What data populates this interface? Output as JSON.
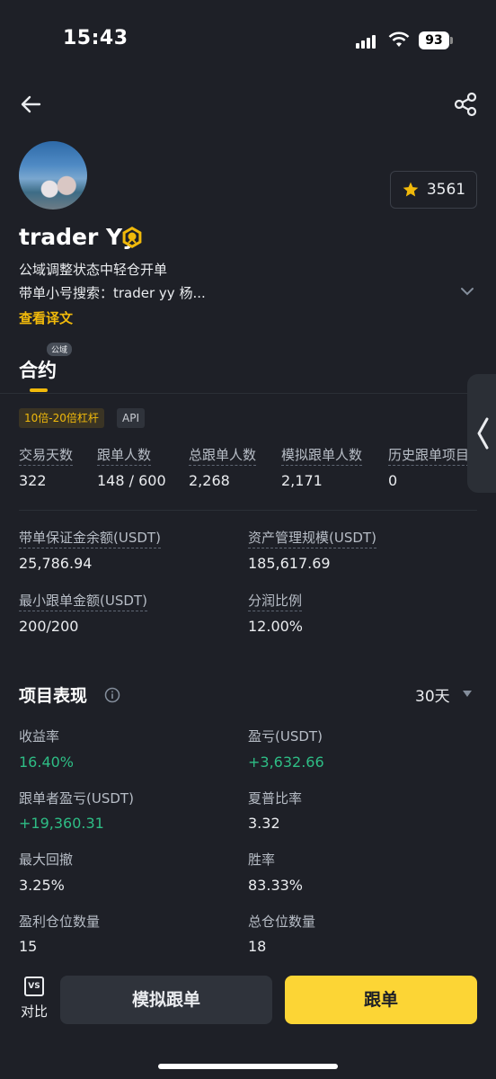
{
  "status_bar": {
    "time": "15:43",
    "battery": "93"
  },
  "profile": {
    "name": "trader Yy",
    "favorites": "3561",
    "bio_line1": "公域调整状态中轻仓开单",
    "bio_line2": "带单小号搜索：trader yy 杨...",
    "translate_link": "查看译文"
  },
  "tabs": {
    "public_tag": "公域",
    "contract": "合约"
  },
  "tags": {
    "leverage": "10倍-20倍杠杆",
    "api": "API"
  },
  "stats": [
    {
      "label": "交易天数",
      "value": "322"
    },
    {
      "label": "跟单人数",
      "value": "148 / 600"
    },
    {
      "label": "总跟单人数",
      "value": "2,268"
    },
    {
      "label": "模拟跟单人数",
      "value": "2,171"
    },
    {
      "label": "历史跟单项目",
      "value": "0"
    }
  ],
  "details": [
    {
      "label": "带单保证金余额(USDT)",
      "value": "25,786.94"
    },
    {
      "label": "资产管理规模(USDT)",
      "value": "185,617.69"
    },
    {
      "label": "最小跟单金额(USDT)",
      "value": "200/200"
    },
    {
      "label": "分润比例",
      "value": "12.00%"
    }
  ],
  "performance": {
    "title": "项目表现",
    "period": "30天",
    "metrics": [
      {
        "label": "收益率",
        "value": "16.40%"
      },
      {
        "label": "盈亏(USDT)",
        "value": "+3,632.66"
      },
      {
        "label": "跟单者盈亏(USDT)",
        "value": "+19,360.31"
      },
      {
        "label": "夏普比率",
        "value": "3.32"
      },
      {
        "label": "最大回撤",
        "value": "3.25%"
      },
      {
        "label": "胜率",
        "value": "83.33%"
      },
      {
        "label": "盈利仓位数量",
        "value": "15"
      },
      {
        "label": "总仓位数量",
        "value": "18"
      }
    ]
  },
  "bottom": {
    "vs_icon": "VS",
    "vs_label": "对比",
    "simulate": "模拟跟单",
    "copy": "跟单"
  },
  "colors": {
    "accent": "#f0b90b",
    "positive": "#2ebd85",
    "background": "#1e2027",
    "primary_button": "#fcd535"
  }
}
